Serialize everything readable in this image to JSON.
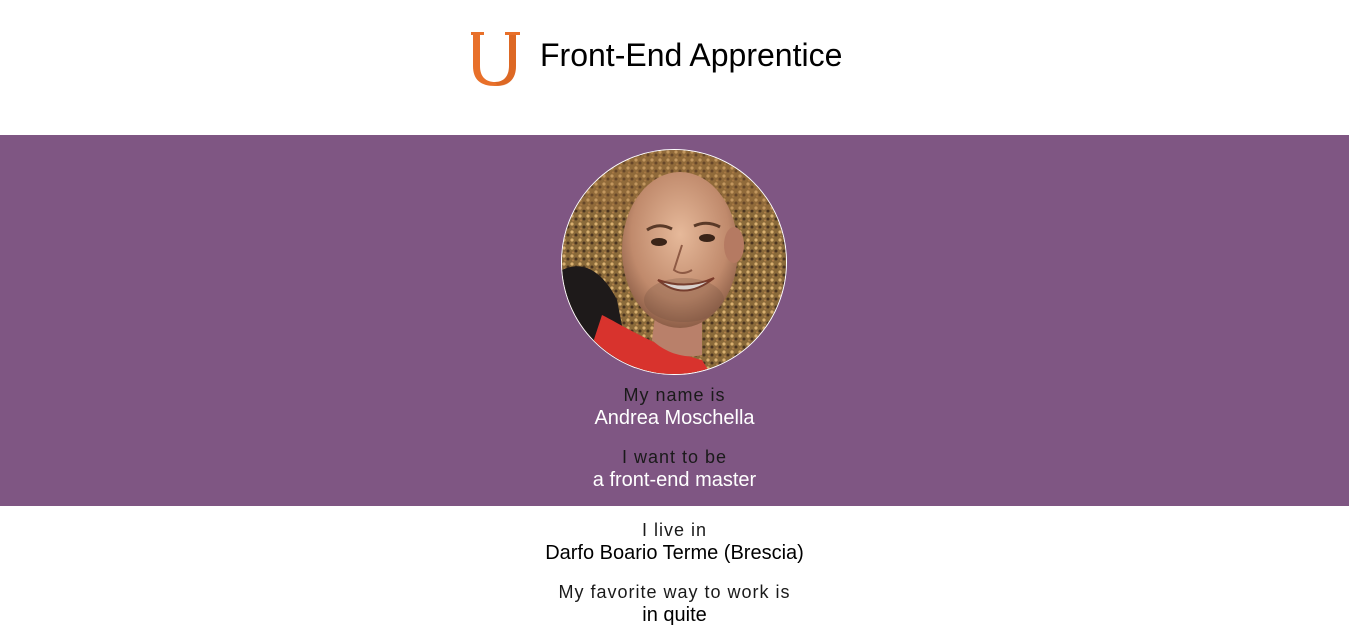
{
  "header": {
    "logo_icon": "udacity-u-icon",
    "title": "Front-End Apprentice"
  },
  "colors": {
    "accent": "#e8702a",
    "band": "#7f5683",
    "white": "#ffffff"
  },
  "profile": {
    "avatar_alt": "profile-photo",
    "name_label": "My name is",
    "name": "Andrea Moschella",
    "goal_label": "I want to be",
    "goal": "a front-end master",
    "location_label": "I live in",
    "location": "Darfo Boario Terme (Brescia)",
    "work_label": "My favorite way to work is",
    "work": "in quite"
  }
}
